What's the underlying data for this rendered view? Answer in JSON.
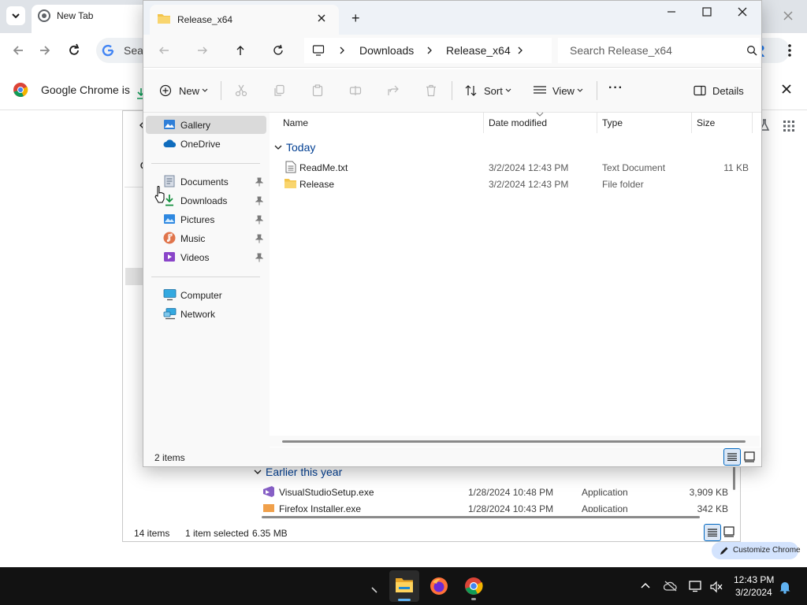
{
  "chrome": {
    "tab_title": "New Tab",
    "omnibox_text": "Sear",
    "infobar_text": "Google Chrome is",
    "customize_label": "Customize Chrome"
  },
  "bg_explorer": {
    "group_label": "Earlier this year",
    "rows": [
      {
        "name": "VisualStudioSetup.exe",
        "date": "1/28/2024 10:48 PM",
        "type": "Application",
        "size": "3,909 KB"
      },
      {
        "name": "Firefox Installer.exe",
        "date": "1/28/2024 10:43 PM",
        "type": "Application",
        "size": "342 KB"
      }
    ],
    "status_count": "14 items",
    "status_selected": "1 item selected",
    "status_size": "6.35 MB"
  },
  "explorer": {
    "tab_title": "Release_x64",
    "add_tab_label": "+",
    "breadcrumb": [
      "Downloads",
      "Release_x64"
    ],
    "search_placeholder": "Search Release_x64",
    "toolbar": {
      "new_label": "New",
      "sort_label": "Sort",
      "view_label": "View",
      "more_label": "···",
      "details_label": "Details"
    },
    "nav": {
      "top": [
        "Gallery",
        "OneDrive"
      ],
      "quick": [
        "Documents",
        "Downloads",
        "Pictures",
        "Music",
        "Videos"
      ],
      "devices": [
        "Computer",
        "Network"
      ]
    },
    "columns": {
      "name": "Name",
      "date": "Date modified",
      "type": "Type",
      "size": "Size"
    },
    "group_label": "Today",
    "files": [
      {
        "name": "ReadMe.txt",
        "date": "3/2/2024 12:43 PM",
        "type": "Text Document",
        "size": "11 KB"
      },
      {
        "name": "Release",
        "date": "3/2/2024 12:43 PM",
        "type": "File folder",
        "size": ""
      }
    ],
    "status_count": "2 items"
  },
  "taskbar": {
    "time": "12:43 PM",
    "date": "3/2/2024"
  },
  "colors": {
    "accent": "#0067c0",
    "taskbar": "#121212",
    "folder": "#f3c44a"
  }
}
